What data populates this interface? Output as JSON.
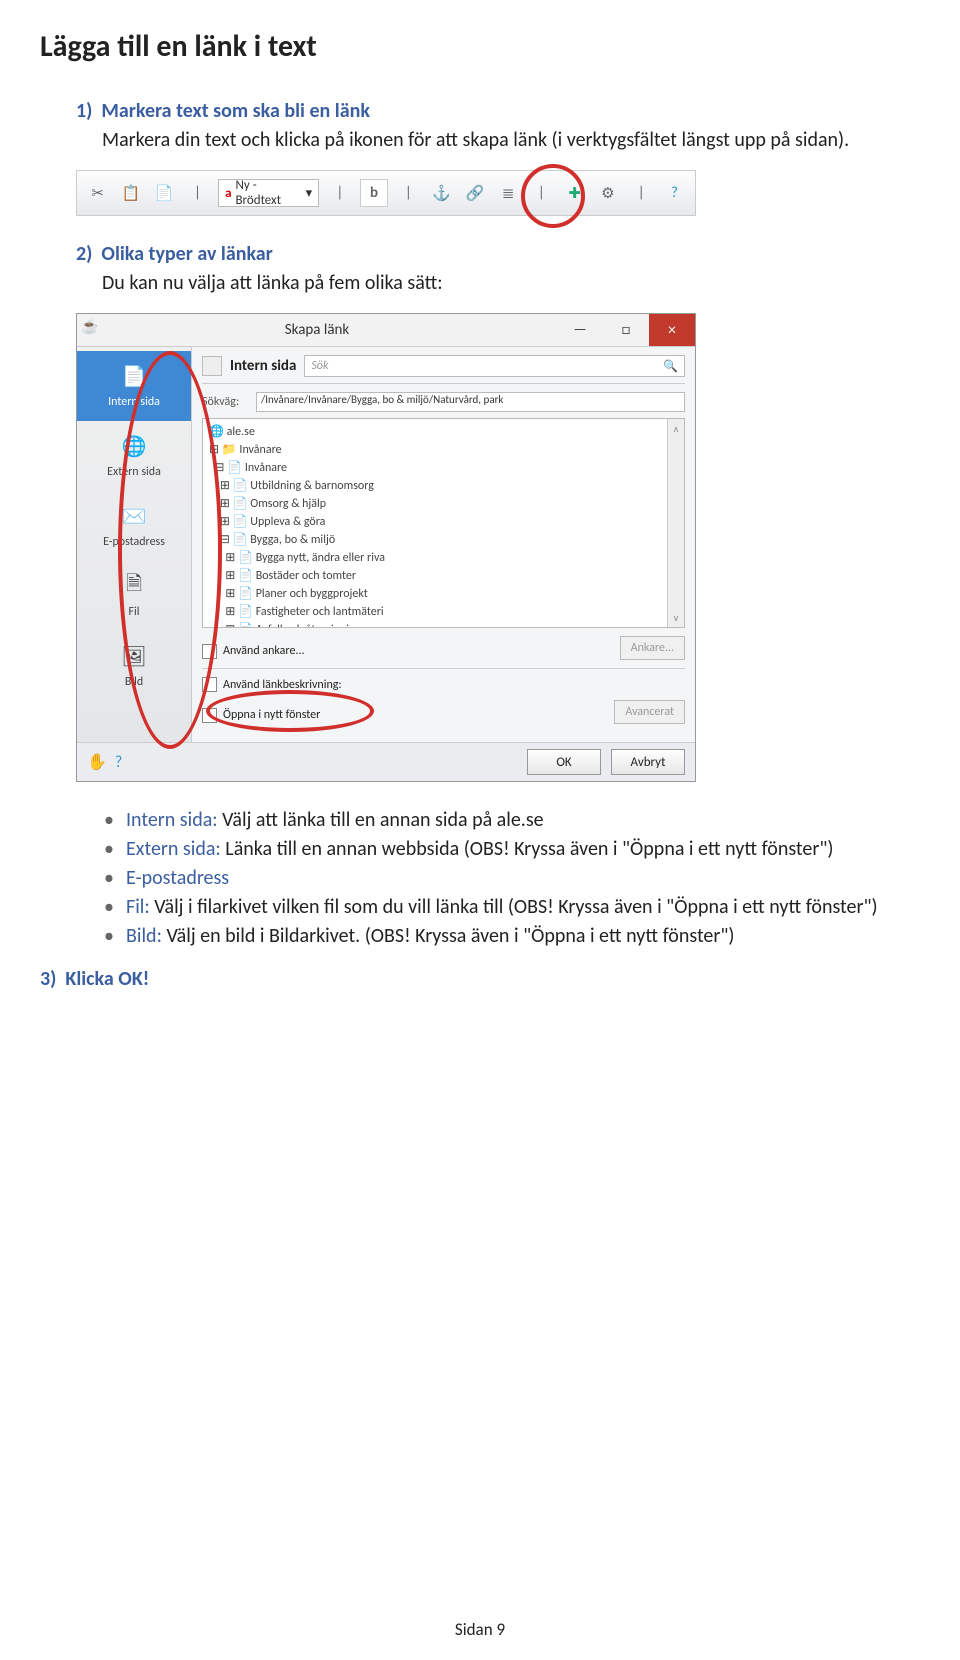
{
  "title": "Lägga till en länk i text",
  "step1": {
    "num": "1)",
    "head": "Markera text som ska bli en länk",
    "body": "Markera din text och klicka på ikonen för att skapa länk (i verktygsfältet längst upp på sidan)."
  },
  "toolbar": {
    "style_label": "Ny - Brödtext"
  },
  "step2": {
    "num": "2)",
    "head": "Olika typer av länkar",
    "body": "Du kan nu välja att länka på fem olika sätt:"
  },
  "dialog": {
    "window_title": "Skapa länk",
    "minimize": "—",
    "maximize": "□",
    "close": "×",
    "sidebar": {
      "items": [
        {
          "label": "Intern sida",
          "active": true
        },
        {
          "label": "Extern sida",
          "active": false
        },
        {
          "label": "E-postadress",
          "active": false
        },
        {
          "label": "Fil",
          "active": false
        },
        {
          "label": "Bild",
          "active": false
        }
      ]
    },
    "tab_label": "Intern sida",
    "search_placeholder": "Sök",
    "path_label": "Sökväg:",
    "path_value": "/Invånare/Invånare/Bygga, bo & miljö/Naturvård, park",
    "tree": [
      "🌐 ale.se",
      "⊟ 📁 Invånare",
      "  ⊟ 📄 Invånare",
      "    ⊞ 📄 Utbildning & barnomsorg",
      "    ⊞ 📄 Omsorg & hjälp",
      "    ⊞ 📄 Uppleva & göra",
      "    ⊟ 📄 Bygga, bo & miljö",
      "      ⊞ 📄 Bygga nytt, ändra eller riva",
      "      ⊞ 📄 Bostäder och tomter",
      "      ⊞ 📄 Planer och byggprojekt",
      "      ⊞ 📄 Fastigheter och lantmäteri",
      "      ⊞ 📄 Avfall och återvinning"
    ],
    "anchor_chk": "Använd ankare...",
    "anchor_btn": "Ankare...",
    "linkdesc_chk": "Använd länkbeskrivning:",
    "newwin_chk": "Öppna i nytt fönster",
    "advanced_btn": "Avancerat",
    "ok_btn": "OK",
    "cancel_btn": "Avbryt"
  },
  "bullets": [
    {
      "label": "Intern sida:",
      "text": " Välj att länka till en annan sida på ale.se"
    },
    {
      "label": "Extern sida:",
      "text": " Länka till en annan webbsida (OBS! Kryssa även i \"Öppna i ett nytt fönster\")"
    },
    {
      "label": "E-postadress",
      "text": ""
    },
    {
      "label": "Fil:",
      "text": " Välj i filarkivet vilken fil som du vill länka till (OBS! Kryssa även i \"Öppna i ett nytt fönster\")"
    },
    {
      "label": "Bild:",
      "text": " Välj en bild i Bildarkivet. (OBS! Kryssa även i \"Öppna i ett nytt fönster\")"
    }
  ],
  "step3": {
    "num": "3)",
    "head": "Klicka OK!"
  },
  "footer": "Sidan 9"
}
